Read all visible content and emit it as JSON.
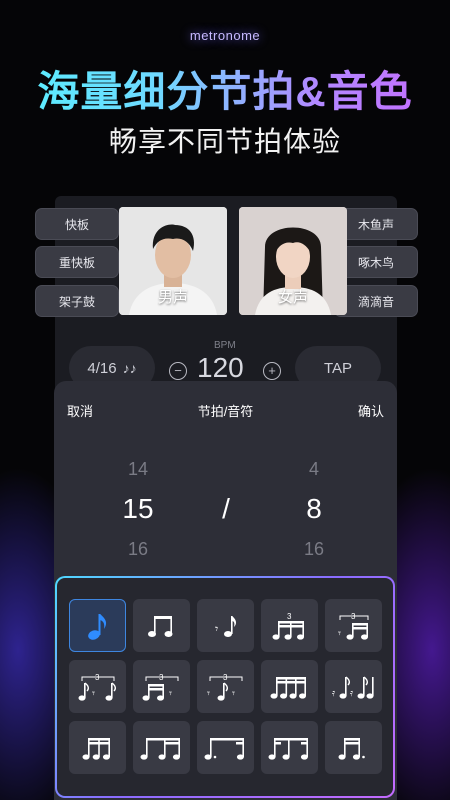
{
  "brand": "metronome",
  "headline": "海量细分节拍&音色",
  "subheadline": "畅享不同节拍体验",
  "left_options": [
    "快板",
    "重快板",
    "架子鼓"
  ],
  "right_options": [
    "木鱼声",
    "啄木鸟",
    "滴滴音"
  ],
  "voices": {
    "male": "男声",
    "female": "女声"
  },
  "bpm": {
    "label": "BPM",
    "value": "120",
    "time_signature": "4/16",
    "tap": "TAP"
  },
  "sheet": {
    "cancel": "取消",
    "title": "节拍/音符",
    "confirm": "确认"
  },
  "picker": {
    "left": {
      "above": "14",
      "selected": "15",
      "below": "16"
    },
    "separator": "/",
    "right": {
      "above": "4",
      "selected": "8",
      "below": "16"
    }
  },
  "note_patterns": [
    "single-eighth",
    "two-eighths",
    "rest-eighth",
    "triplet-sixteenths",
    "rest-triplet",
    "triplet-rest-mix-1",
    "triplet-rest-mix-2",
    "triplet-rest-mix-3",
    "four-sixteenths",
    "rest-sixteenth-mix",
    "three-sixteenths",
    "eighth-two-sixteenths",
    "dotted-eighth-sixteenth",
    "sixteenth-eighth-sixteenth",
    "dotted-rhythm"
  ],
  "selected_pattern": "single-eighth",
  "colors": {
    "accent_blue": "#2f8cff",
    "gradient_start": "#57f0ff",
    "gradient_end": "#c86bff"
  }
}
